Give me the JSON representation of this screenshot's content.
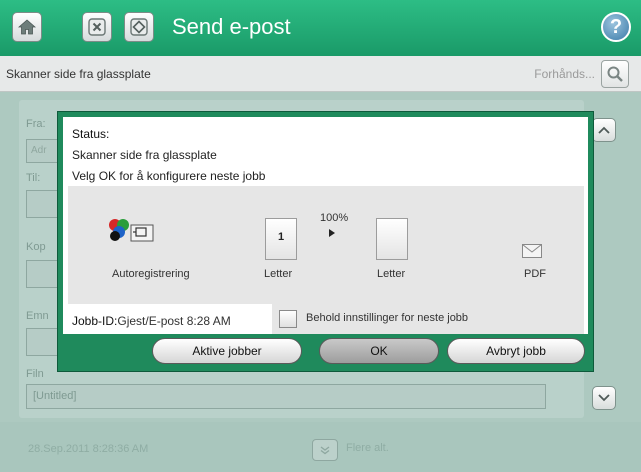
{
  "header": {
    "title": "Send e-post",
    "home_icon": "home-icon",
    "stop_icon": "stop-icon",
    "start_icon": "start-icon",
    "help_icon": "help-icon",
    "help_glyph": "?"
  },
  "statusbar": {
    "message": "Skanner side fra glassplate",
    "preview_label": "Forhånds...",
    "preview_icon": "magnifier-icon"
  },
  "background_form": {
    "labels": [
      "Fra:",
      "Til:",
      "Kop",
      "Emn",
      "Filn"
    ],
    "from_placeholder": "Adr",
    "filename_value": "[Untitled]"
  },
  "footer": {
    "timestamp": "28.Sep.2011 8:28:36 AM",
    "more_options": "Flere alt."
  },
  "dialog": {
    "status_label": "Status:",
    "line1": "Skanner side fra glassplate",
    "line2": "Velg OK for å konfigurere neste jobb",
    "workflow": {
      "scale_pct": "100%",
      "source_label": "Autoregistrering",
      "page_count": "1",
      "input_label": "Letter",
      "output_label": "Letter",
      "format_label": "PDF"
    },
    "job_id_label": "Jobb-ID:",
    "job_id_value": "Gjest/E-post 8:28 AM",
    "keep_settings_label": "Behold innstillinger for neste jobb",
    "buttons": {
      "active_jobs": "Aktive jobber",
      "ok": "OK",
      "cancel_job": "Avbryt jobb"
    }
  },
  "colors": {
    "header_green": "#1a9a68",
    "dialog_border": "#1f8a5c",
    "background": "#a9c6bd"
  }
}
